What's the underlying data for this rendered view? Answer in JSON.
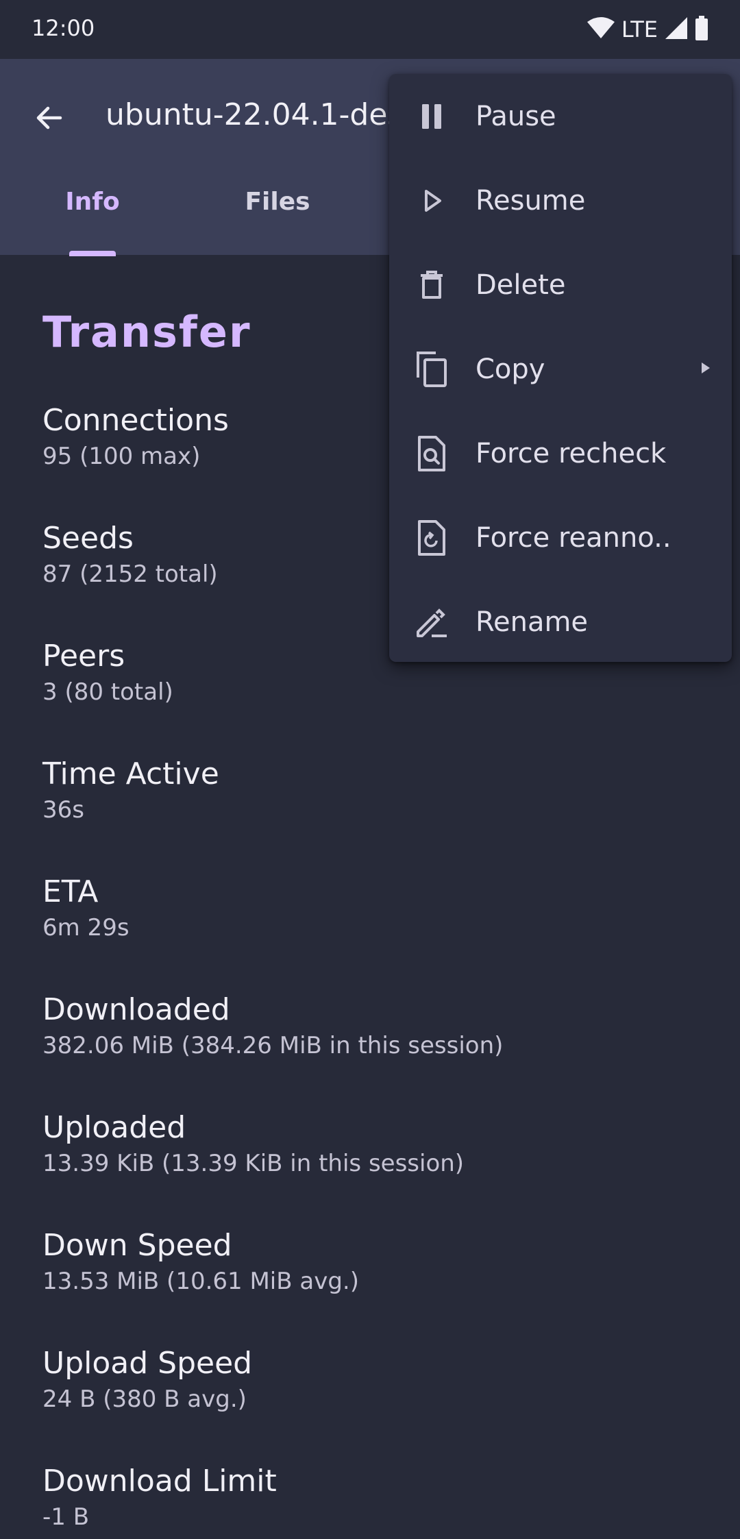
{
  "status_bar": {
    "time": "12:00",
    "network": "LTE"
  },
  "app_bar": {
    "title": "ubuntu-22.04.1-desktop-amd64.iso",
    "tabs": [
      {
        "label": "Info",
        "selected": true
      },
      {
        "label": "Files",
        "selected": false
      }
    ]
  },
  "transfer": {
    "title": "Transfer",
    "items": [
      {
        "label": "Connections",
        "value": "95 (100 max)"
      },
      {
        "label": "Seeds",
        "value": "87 (2152 total)"
      },
      {
        "label": "Peers",
        "value": "3 (80 total)"
      },
      {
        "label": "Time Active",
        "value": "36s"
      },
      {
        "label": "ETA",
        "value": "6m 29s"
      },
      {
        "label": "Downloaded",
        "value": "382.06 MiB (384.26 MiB in this session)"
      },
      {
        "label": "Uploaded",
        "value": "13.39 KiB (13.39 KiB in this session)"
      },
      {
        "label": "Down Speed",
        "value": "13.53 MiB (10.61 MiB avg.)"
      },
      {
        "label": "Upload Speed",
        "value": "24 B (380 B avg.)"
      },
      {
        "label": "Download Limit",
        "value": "-1 B"
      }
    ]
  },
  "menu": {
    "items": [
      {
        "label": "Pause",
        "icon": "pause-icon"
      },
      {
        "label": "Resume",
        "icon": "play-icon"
      },
      {
        "label": "Delete",
        "icon": "trash-icon"
      },
      {
        "label": "Copy",
        "icon": "copy-icon",
        "has_submenu": true
      },
      {
        "label": "Force recheck",
        "icon": "file-search-icon"
      },
      {
        "label": "Force reanno..",
        "icon": "file-refresh-icon"
      },
      {
        "label": "Rename",
        "icon": "edit-icon"
      }
    ]
  },
  "colors": {
    "accent": "#d5b8ff",
    "background": "#272a39",
    "app_bar": "#3b3f58",
    "menu": "#2b2e40"
  }
}
